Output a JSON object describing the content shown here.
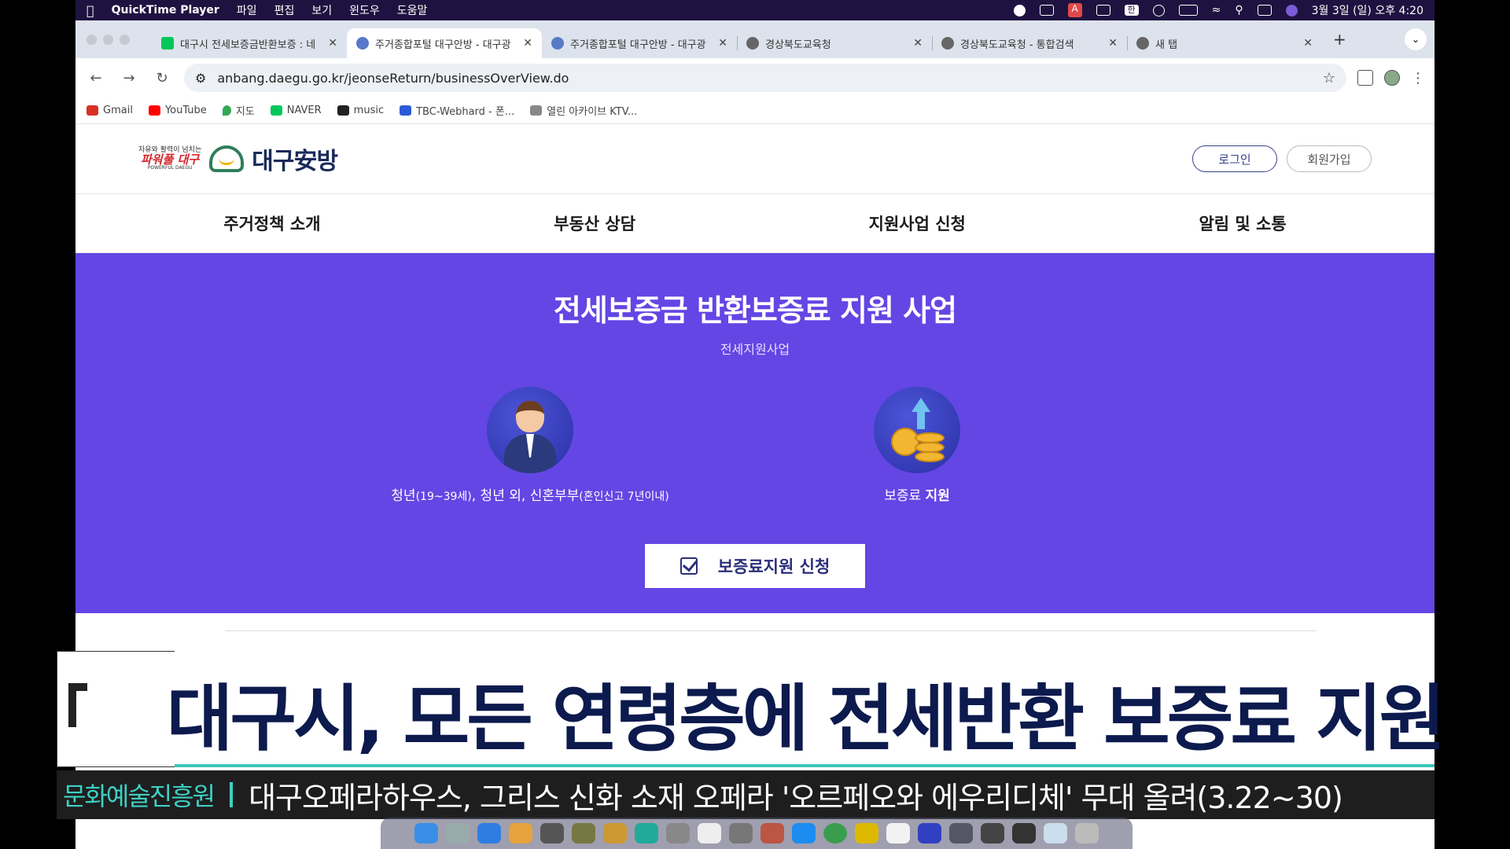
{
  "menubar": {
    "app_name": "QuickTime Player",
    "menus": [
      "파일",
      "편집",
      "보기",
      "윈도우",
      "도움말"
    ],
    "clock": "3월 3일 (일) 오후 4:20",
    "tray_badge_a": "A",
    "tray_badge_han": "한"
  },
  "tabs": [
    {
      "title": "대구시 전세보증금반환보증 : 네",
      "favicon_color": "#03c75a",
      "active": false
    },
    {
      "title": "주거종합포털 대구안방 - 대구광",
      "favicon_color": "#5a78c8",
      "active": true
    },
    {
      "title": "주거종합포털 대구안방 - 대구광",
      "favicon_color": "#5a78c8",
      "active": false
    },
    {
      "title": "경상북도교육청",
      "favicon_color": "#666666",
      "active": false
    },
    {
      "title": "경상북도교육청 - 통합검색",
      "favicon_color": "#666666",
      "active": false
    },
    {
      "title": "새 탭",
      "favicon_color": "#666666",
      "active": false
    }
  ],
  "address": {
    "url": "anbang.daegu.go.kr/jeonseReturn/businessOverView.do"
  },
  "bookmarks": [
    {
      "label": "Gmail",
      "color": "#d93025"
    },
    {
      "label": "YouTube",
      "color": "#ff0000"
    },
    {
      "label": "지도",
      "color": "#34a853"
    },
    {
      "label": "NAVER",
      "color": "#03c75a"
    },
    {
      "label": "music",
      "color": "#222222"
    },
    {
      "label": "TBC-Webhard - 폰...",
      "color": "#2a5bd7"
    },
    {
      "label": "열린 아카이브 KTV...",
      "color": "#888888"
    }
  ],
  "site": {
    "logo_slogan_top": "자유와 활력이 넘치는",
    "logo_slogan_main": "파워풀 대구",
    "logo_slogan_en": "POWERFUL DAEGU",
    "logo_name": "대구安방",
    "login_label": "로그인",
    "signup_label": "회원가입",
    "nav": [
      "주거정책 소개",
      "부동산 상담",
      "지원사업 신청",
      "알림 및 소통"
    ],
    "hero": {
      "title": "전세보증금 반환보증료 지원 사업",
      "subtitle": "전세지원사업",
      "feature1_main1": "청년",
      "feature1_small1": "(19~39세)",
      "feature1_main2": ", 청년 외, 신혼부부",
      "feature1_small2": "(혼인신고 7년이내)",
      "feature2_main": "보증료 ",
      "feature2_bold": "지원",
      "apply_label": "보증료지원 신청"
    },
    "accent_color": "#6346e4"
  },
  "news": {
    "headline": "대구시, 모든 연령층에 전세반환 보증료 지원",
    "ticker_tag": "문화예술진흥원",
    "ticker_text": "대구오페라하우스, 그리스 신화 소재 오페라 '오르페오와 에우리디체' 무대 올려(3.22~30)"
  }
}
